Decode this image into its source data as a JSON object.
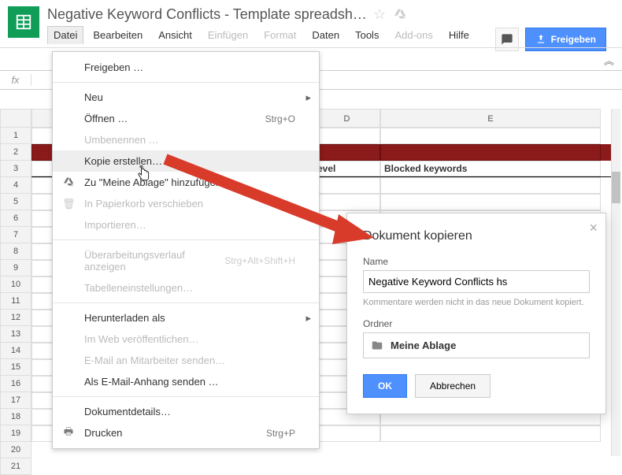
{
  "doc_title": "Negative Keyword Conflicts - Template spreadsh…",
  "menubar": {
    "datei": "Datei",
    "bearbeiten": "Bearbeiten",
    "ansicht": "Ansicht",
    "einfuegen": "Einfügen",
    "format": "Format",
    "daten": "Daten",
    "tools": "Tools",
    "addons": "Add-ons",
    "hilfe": "Hilfe"
  },
  "share_button": "Freigeben",
  "columns": {
    "D": "D",
    "E": "E"
  },
  "row_numbers": [
    "1",
    "2",
    "3",
    "4",
    "5",
    "6",
    "7",
    "8",
    "9",
    "10",
    "11",
    "12",
    "13",
    "14",
    "15",
    "16",
    "17",
    "18",
    "19",
    "20",
    "21"
  ],
  "header_cells": {
    "level": "evel",
    "blocked": "Blocked keywords"
  },
  "file_menu": {
    "freigeben": "Freigeben …",
    "neu": "Neu",
    "oeffnen": "Öffnen …",
    "oeffnen_sc": "Strg+O",
    "umbenennen": "Umbenennen …",
    "kopie": "Kopie erstellen…",
    "ablage": "Zu \"Meine Ablage\" hinzufügen",
    "papierkorb": "In Papierkorb verschieben",
    "importieren": "Importieren…",
    "verlauf": "Überarbeitungsverlauf anzeigen",
    "verlauf_sc": "Strg+Alt+Shift+H",
    "tabellen": "Tabelleneinstellungen…",
    "herunterladen": "Herunterladen als",
    "webveroff": "Im Web veröffentlichen…",
    "email_mitarbeiter": "E-Mail an Mitarbeiter senden…",
    "email_anhang": "Als E-Mail-Anhang senden …",
    "details": "Dokumentdetails…",
    "drucken": "Drucken",
    "drucken_sc": "Strg+P"
  },
  "dialog": {
    "title": "Dokument kopieren",
    "name_label": "Name",
    "name_value": "Negative Keyword Conflicts hs",
    "hint": "Kommentare werden nicht in das neue Dokument kopiert.",
    "folder_label": "Ordner",
    "folder_value": "Meine Ablage",
    "ok": "OK",
    "cancel": "Abbrechen"
  }
}
